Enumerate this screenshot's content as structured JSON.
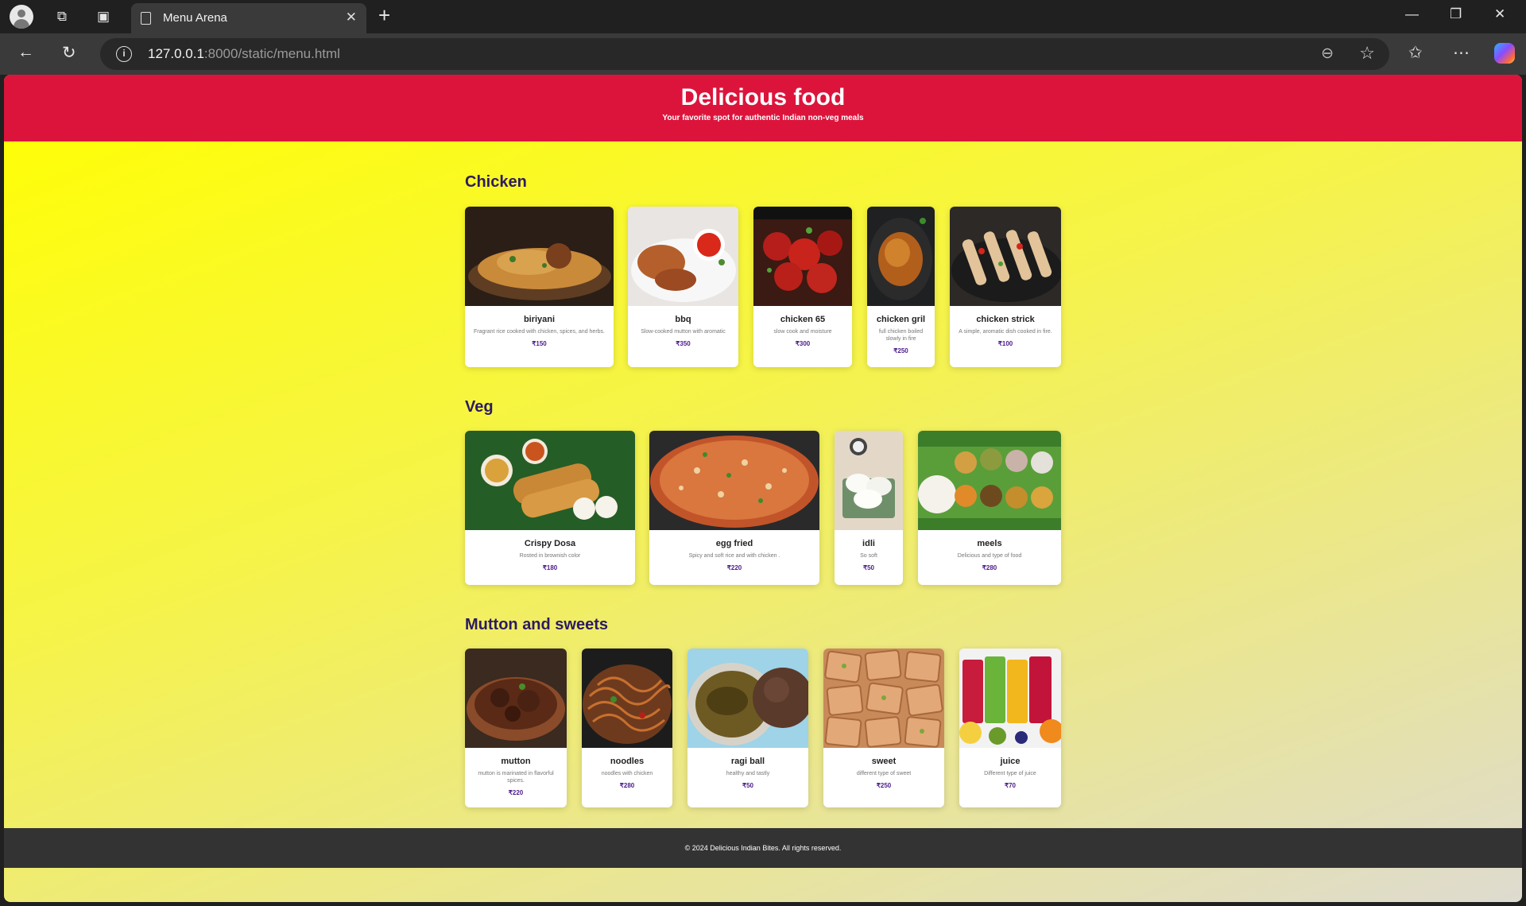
{
  "browser": {
    "tab_title": "Menu Arena",
    "url_host": "127.0.0.1",
    "url_path": ":8000/static/menu.html"
  },
  "header": {
    "title": "Delicious food",
    "subtitle": "Your favorite spot for authentic Indian non-veg meals"
  },
  "sections": [
    {
      "title": "Chicken",
      "items": [
        {
          "name": "biriyani",
          "desc": "Fragrant rice cooked with chicken, spices, and herbs.",
          "price": "₹150"
        },
        {
          "name": "bbq",
          "desc": "Slow-cooked mutton with aromatic",
          "price": "₹350"
        },
        {
          "name": "chicken 65",
          "desc": "slow cook and moisture",
          "price": "₹300"
        },
        {
          "name": "chicken gril",
          "desc": "full chicken boiled slowly in fire",
          "price": "₹250"
        },
        {
          "name": "chicken strick",
          "desc": "A simple, aromatic dish cooked in fire.",
          "price": "₹100"
        }
      ]
    },
    {
      "title": "Veg",
      "items": [
        {
          "name": "Crispy Dosa",
          "desc": "Rosted in brownish color",
          "price": "₹180"
        },
        {
          "name": "egg fried",
          "desc": "Spicy and soft rice and with chicken .",
          "price": "₹220"
        },
        {
          "name": "idli",
          "desc": "So soft",
          "price": "₹50"
        },
        {
          "name": "meels",
          "desc": "Delicious and type of food",
          "price": "₹280"
        }
      ]
    },
    {
      "title": "Mutton and sweets",
      "items": [
        {
          "name": "mutton",
          "desc": "mutton is marinated in flavorful spices.",
          "price": "₹220"
        },
        {
          "name": "noodles",
          "desc": "noodles with chicken",
          "price": "₹280"
        },
        {
          "name": "ragi ball",
          "desc": "healthy and tastly",
          "price": "₹50"
        },
        {
          "name": "sweet",
          "desc": "different type of sweet",
          "price": "₹250"
        },
        {
          "name": "juice",
          "desc": "Different type of juice",
          "price": "₹70"
        }
      ]
    }
  ],
  "footer": {
    "text": "© 2024 Delicious Indian Bites. All rights reserved."
  }
}
